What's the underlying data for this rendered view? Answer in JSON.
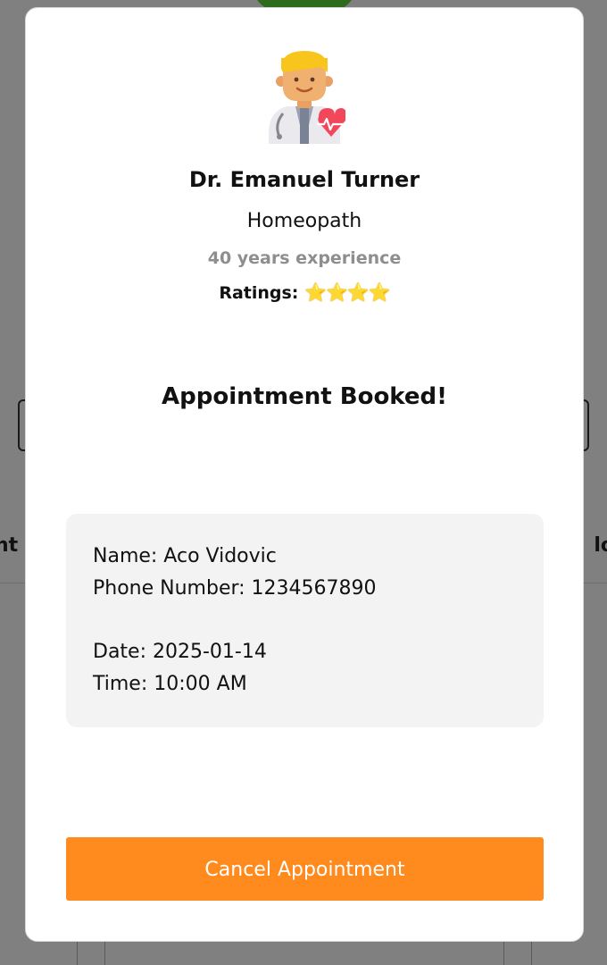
{
  "doctor": {
    "name": "Dr. Emanuel Turner",
    "specialty": "Homeopath",
    "experience": "40 years experience",
    "ratings_label": "Ratings:",
    "ratings_stars": "⭐⭐⭐⭐",
    "avatar_icon": "doctor-avatar-icon"
  },
  "booking": {
    "title": "Appointment Booked!",
    "name_line": "Name: Aco Vidovic",
    "phone_line": "Phone Number: 1234567890",
    "date_line": "Date: 2025-01-14",
    "time_line": "Time: 10:00 AM"
  },
  "actions": {
    "cancel_label": "Cancel Appointment"
  },
  "colors": {
    "accent": "#ff8a1d",
    "overlay": "#808080",
    "card_bg": "#f3f3f3",
    "muted_text": "#8e8e8e"
  }
}
